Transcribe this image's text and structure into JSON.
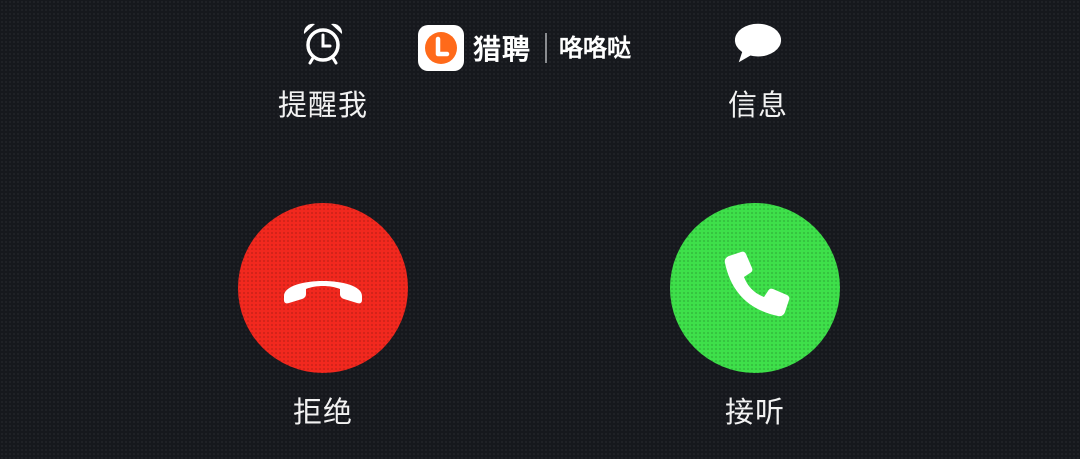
{
  "actions": {
    "remind_label": "提醒我",
    "remind_icon": "alarm-clock-icon",
    "message_label": "信息",
    "message_icon": "speech-bubble-icon"
  },
  "brand": {
    "logo_letter": "L",
    "name": "猎聘",
    "sub_name": "咯咯哒",
    "logo_color": "#ff6a1a"
  },
  "call": {
    "decline_label": "拒绝",
    "decline_icon": "hang-up-phone-icon",
    "decline_color": "#f2281e",
    "accept_label": "接听",
    "accept_icon": "phone-handset-icon",
    "accept_color": "#3ee04a"
  }
}
